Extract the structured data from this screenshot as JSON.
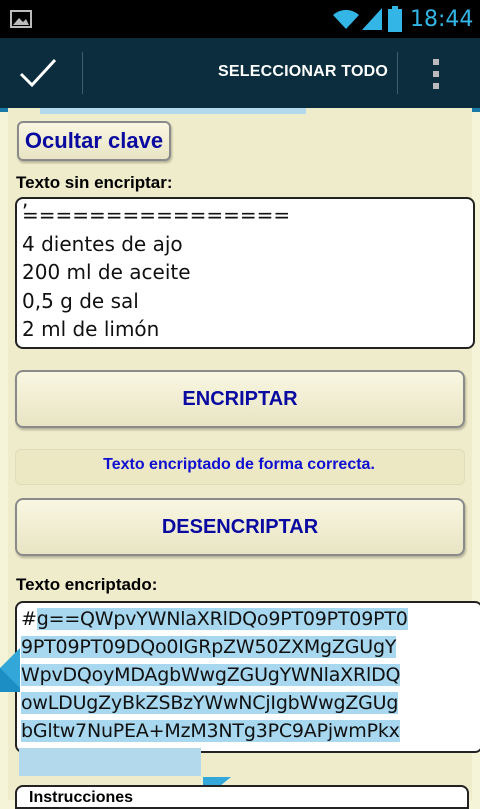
{
  "status_bar": {
    "time": "18:44",
    "time_color": "#33b5e5"
  },
  "action_bar": {
    "select_all_label": "SELECCIONAR TODO"
  },
  "form": {
    "hide_key_label": "Ocultar clave",
    "plain_text_label": "Texto sin encriptar:",
    "plain_text_lines": [
      "================",
      "4 dientes de ajo",
      "200 ml de aceite",
      "0,5 g de sal",
      "2 ml de limón"
    ],
    "encrypt_label": "ENCRIPTAR",
    "status_message": "Texto encriptado de forma correcta.",
    "decrypt_label": "DESENCRIPTAR",
    "encrypted_label": "Texto encriptado:",
    "encrypted_prefix": "#",
    "encrypted_lines": [
      "g==QWpvYWNlaXRlDQo9PT09PT09PT0",
      "9PT09PT09DQo0IGRpZW50ZXMgZGUgY",
      "WpvDQoyMDAgbWwgZGUgYWNlaXRlDQ",
      "owLDUgZyBkZSBzYWwNCjIgbWwgZGUg",
      "bGltw7NuPEA+MzM3NTg3PC9APjwmPkx"
    ],
    "bottom_label": "Instrucciones"
  },
  "colors": {
    "action_bar": "#0b2d3e",
    "button_text": "#0a0aa0",
    "selection": "#a8d8ef"
  }
}
